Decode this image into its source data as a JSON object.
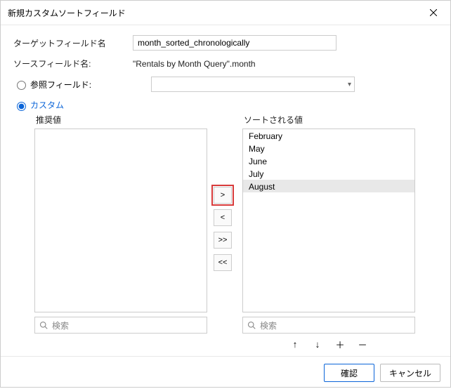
{
  "dialog": {
    "title": "新規カスタムソートフィールド"
  },
  "form": {
    "target_label": "ターゲットフィールド名",
    "target_value": "month_sorted_chronologically",
    "source_label": "ソースフィールド名:",
    "source_value": "\"Rentals by Month Query\".month",
    "ref_label": "参照フィールド:",
    "custom_label": "カスタム"
  },
  "suggested": {
    "header": "推奨値",
    "items": [],
    "search_placeholder": "検索"
  },
  "sorted": {
    "header": "ソートされる値",
    "items": [
      "February",
      "May",
      "June",
      "July",
      "August"
    ],
    "selected_index": 4,
    "search_placeholder": "検索"
  },
  "buttons": {
    "move_right": ">",
    "move_left": "<",
    "move_all_right": ">>",
    "move_all_left": "<<"
  },
  "reorder": {
    "up": "↑",
    "down": "↓",
    "add": "＋",
    "remove": "－"
  },
  "footer": {
    "ok": "確認",
    "cancel": "キャンセル"
  }
}
